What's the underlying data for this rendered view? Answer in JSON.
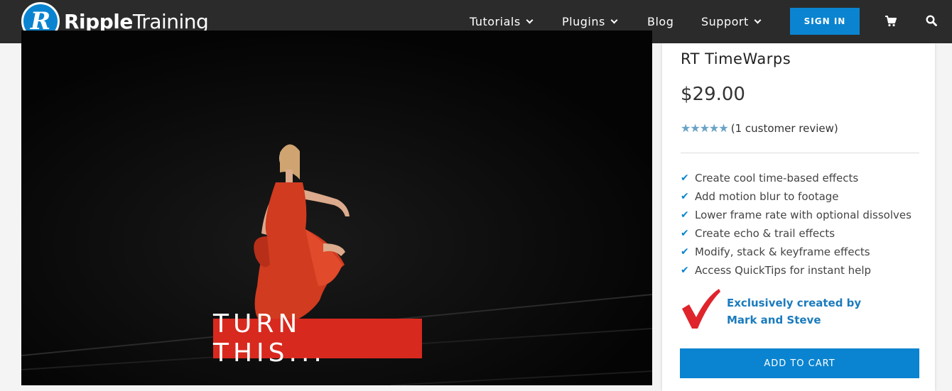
{
  "header": {
    "logo_letter": "R",
    "logo_bold": "Ripple",
    "logo_light": "Training",
    "nav": [
      {
        "label": "Tutorials",
        "has_menu": true
      },
      {
        "label": "Plugins",
        "has_menu": true
      },
      {
        "label": "Blog",
        "has_menu": false
      },
      {
        "label": "Support",
        "has_menu": true
      }
    ],
    "signin_label": "SIGN IN",
    "cart_icon": "shopping-cart-icon",
    "search_icon": "search-icon"
  },
  "video": {
    "caption": "TURN THIS..."
  },
  "product": {
    "title": "RT TimeWarps",
    "price": "$29.00",
    "rating_stars": "★★★★★",
    "rating": 5,
    "review_text": "(1 customer review)",
    "features": [
      "Create cool time-based effects",
      "Add motion blur to footage",
      "Lower frame rate with optional dissolves",
      "Create echo & trail effects",
      "Modify, stack & keyframe effects",
      "Access QuickTips for instant help"
    ],
    "promo_line1": "Exclusively created by",
    "promo_line2": "Mark and Steve",
    "add_to_cart": "ADD TO CART"
  },
  "colors": {
    "accent": "#0a84d0",
    "header_bg": "#2b2b2b",
    "caption_bg": "#d8291f",
    "star": "#6aa3c5"
  }
}
